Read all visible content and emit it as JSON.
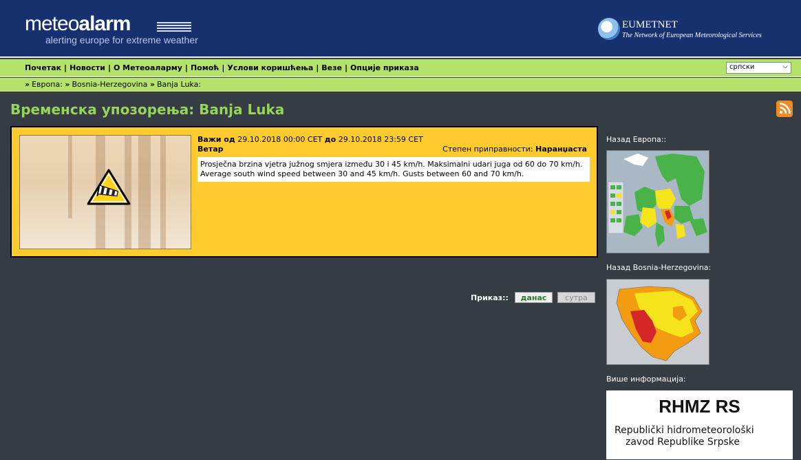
{
  "header": {
    "logo_prefix": "meteo",
    "logo_bold": "alarm",
    "tagline": "alerting europe for extreme weather",
    "partner_name": "EUMETNET",
    "partner_sub": "The Network of European Meteorological Services"
  },
  "nav": {
    "items": [
      "Почетак",
      "Новости",
      "О Метеоаларму",
      "Помоћ",
      "Услови коришћења",
      "Везе",
      "Опције приказа"
    ],
    "language": "српски"
  },
  "breadcrumb": [
    "Европа:",
    "Bosnia-Herzegovina",
    "Banja Luka:"
  ],
  "page_title": "Временска упозорења: Banja Luka",
  "warning": {
    "valid_from_label": "Важи од",
    "valid_from": "29.10.2018 00:00 CET",
    "valid_to_label": "до",
    "valid_to": "29.10.2018 23:59 CET",
    "event": "Ветар",
    "awareness_label": "Степен приправности:",
    "awareness_level": "Наранџаста",
    "description": "Prosječna brzina vjetra južnog smjera između 30 i 45 km/h. Maksimalni udari juga od 60 do 70 km/h. Average south wind speed between 30 and 45 km/h. Gusts between 60 and 70 km/h."
  },
  "display": {
    "label": "Приказ::",
    "today": "данас",
    "tomorrow": "сутра"
  },
  "sidebar": {
    "back_europe": "Назад Европа::",
    "back_country": "Назад Bosnia-Herzegovina:",
    "more_info": "Више информација:",
    "rhmz_title": "RHMZ RS",
    "rhmz_line1": "Republički hidrometeorološki",
    "rhmz_line2": "zavod Republike Srpske"
  },
  "colors": {
    "header_bg": "#17306e",
    "nav_bg": "#b5e26b",
    "page_bg": "#353c44",
    "title_green": "#96d45a",
    "warning_orange": "#ffcb2e"
  }
}
